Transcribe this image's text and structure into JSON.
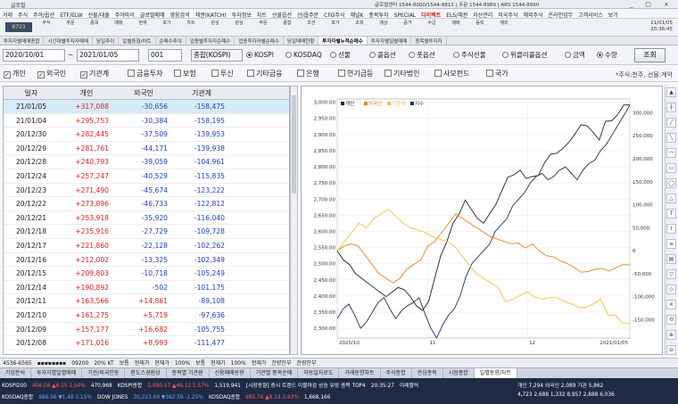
{
  "app": {
    "title": "글로벌",
    "info": "글로벌센터 1544-8000/1544-8811 | 주문 1544-8989 | ARS 1544-8990",
    "winbtns": "_ □ ×"
  },
  "menu": [
    "거래",
    "주식",
    "주야/옵션",
    "ETF/ELW",
    "선물/대출",
    "주야마이",
    "글로벌매매",
    "영웅검색",
    "채권(KATCH)",
    "투자정보",
    "차트",
    "선물옵션",
    "선/옵주문",
    "CFD주식",
    "채널K",
    "종목투자",
    "SPECIAL",
    "다이렉트",
    "ELS/채권",
    "자산관리",
    "미국주식",
    "해외주식",
    "온라인업무",
    "고객서비스",
    "보기"
  ],
  "menu_hot": "다이렉트",
  "toolbar": {
    "account": "8723",
    "items": [
      "주식",
      "주문",
      "종목",
      "매매",
      "현재",
      "호가",
      "차트",
      "관심",
      "관심",
      "주문",
      "종합",
      "조건",
      "호가",
      "조회",
      "예상",
      "증거",
      "수급",
      "매매",
      "등락",
      "해외"
    ],
    "clock_date": "21/01/05",
    "clock_time": "20:36:45"
  },
  "tabs": [
    "투자자별매매종합",
    "시간대별투자자매매",
    "당일추이",
    "일별동향/차트",
    "순매수추이",
    "업종별투자자순매수",
    "업종투자자별순매수",
    "당일매매현황",
    "투자자별누적순매수",
    "투자자별일별매매",
    "종목별투자자"
  ],
  "tabs_active": "투자자별누적순매수",
  "query": {
    "date_from": "2020/10/01",
    "date_to": "2021/01/05",
    "code": "001",
    "name": "종합(KOSPI)",
    "markets": [
      "KOSPI",
      "KOSDAQ",
      "선물",
      "콜옵션",
      "풋옵션",
      "주식선물",
      "위클리콜옵션"
    ],
    "market_selected": "KOSPI",
    "units": [
      "금액",
      "수량"
    ],
    "unit_selected": "수량",
    "search_label": "조회"
  },
  "investors": [
    {
      "label": "개인",
      "checked": true
    },
    {
      "label": "외국인",
      "checked": true
    },
    {
      "label": "기관계",
      "checked": true
    },
    {
      "label": "금융투자",
      "checked": false
    },
    {
      "label": "보험",
      "checked": false
    },
    {
      "label": "투신",
      "checked": false
    },
    {
      "label": "기타금융",
      "checked": false
    },
    {
      "label": "은행",
      "checked": false
    },
    {
      "label": "연기금등",
      "checked": false
    },
    {
      "label": "기타법인",
      "checked": false
    },
    {
      "label": "사모펀드",
      "checked": false
    },
    {
      "label": "국가",
      "checked": false
    }
  ],
  "unit_note": "*주식:천주, 선물:계약",
  "table": {
    "headers": [
      "일자",
      "개인",
      "외국인",
      "기관계"
    ],
    "rows": [
      [
        "21/01/05",
        "+317,088",
        "-30,656",
        "-158,475"
      ],
      [
        "21/01/04",
        "+295,753",
        "-30,384",
        "-158,195"
      ],
      [
        "20/12/30",
        "+282,445",
        "-37,509",
        "-139,953"
      ],
      [
        "20/12/29",
        "+281,761",
        "-44,171",
        "-139,938"
      ],
      [
        "20/12/28",
        "+240,793",
        "-39,059",
        "-104,961"
      ],
      [
        "20/12/24",
        "+257,247",
        "-40,529",
        "-115,835"
      ],
      [
        "20/12/23",
        "+271,490",
        "-45,674",
        "-123,222"
      ],
      [
        "20/12/22",
        "+273,896",
        "-46,733",
        "-122,812"
      ],
      [
        "20/12/21",
        "+253,918",
        "-35,920",
        "-116,040"
      ],
      [
        "20/12/18",
        "+235,916",
        "-27,729",
        "-109,728"
      ],
      [
        "20/12/17",
        "+221,860",
        "-22,128",
        "-102,262"
      ],
      [
        "20/12/16",
        "+212,002",
        "-13,325",
        "-102,349"
      ],
      [
        "20/12/15",
        "+209,803",
        "-10,718",
        "-105,249"
      ],
      [
        "20/12/14",
        "+190,892",
        "-502",
        "-101,175"
      ],
      [
        "20/12/11",
        "+163,566",
        "+14,861",
        "-89,108"
      ],
      [
        "20/12/10",
        "+161,275",
        "+5,719",
        "-97,636"
      ],
      [
        "20/12/09",
        "+157,177",
        "+16,682",
        "-105,755"
      ],
      [
        "20/12/08",
        "+171,016",
        "+8,993",
        "-111,477"
      ]
    ]
  },
  "chart_data": {
    "type": "line",
    "legend": [
      "개인",
      "외국인",
      "기관계",
      "지수"
    ],
    "colors": {
      "개인": "#222222",
      "외국인": "#e8841a",
      "기관계": "#f0c040",
      "지수": "#22305a"
    },
    "x_labels": [
      "2020/10",
      "11",
      "12",
      "2021/01/05"
    ],
    "left_axis": {
      "ticks": [
        "3,000.00",
        "2,950.00",
        "2,900.00",
        "2,850.00",
        "2,800.00",
        "2,750.00",
        "2,700.00",
        "2,650.00",
        "2,600.00",
        "2,550.00",
        "2,500.00",
        "2,450.00",
        "2,400.00",
        "2,350.00",
        "2,300.00"
      ],
      "range": [
        2270,
        3010
      ]
    },
    "right_axis": {
      "ticks": [
        "300,000",
        "250,000",
        "200,000",
        "150,000",
        "100,000",
        "50,000",
        "0",
        "-50,000",
        "-100,000",
        "-150,000"
      ],
      "range": [
        -190000,
        330000
      ]
    },
    "series": [
      {
        "name": "지수",
        "axis": "left",
        "values": [
          2330,
          2360,
          2375,
          2340,
          2300,
          2320,
          2350,
          2380,
          2395,
          2360,
          2330,
          2355,
          2370,
          2380,
          2395,
          2345,
          2300,
          2270,
          2310,
          2340,
          2360,
          2400,
          2460,
          2500,
          2520,
          2540,
          2560,
          2600,
          2620,
          2640,
          2680,
          2700,
          2720,
          2750,
          2770,
          2780,
          2760,
          2770,
          2790,
          2800,
          2780,
          2760,
          2790,
          2810,
          2820,
          2850,
          2870,
          2900,
          2930,
          2960,
          2990
        ]
      },
      {
        "name": "개인",
        "axis": "right",
        "values": [
          0,
          -20000,
          -30000,
          -50000,
          -60000,
          -70000,
          -80000,
          -90000,
          -100000,
          -90000,
          -80000,
          -85000,
          -100000,
          -120000,
          -130000,
          -110000,
          -60000,
          -10000,
          20000,
          60000,
          80000,
          110000,
          90000,
          70000,
          60000,
          80000,
          100000,
          130000,
          160000,
          165000,
          175000,
          157177,
          161275,
          163566,
          190892,
          209803,
          212002,
          221860,
          235916,
          253918,
          273896,
          271490,
          257247,
          240793,
          281761,
          282445,
          295753,
          317088,
          317088
        ]
      },
      {
        "name": "외국인",
        "axis": "right",
        "values": [
          0,
          10000,
          15000,
          10000,
          -10000,
          -30000,
          -50000,
          -60000,
          -70000,
          -60000,
          -40000,
          -30000,
          -20000,
          10000,
          20000,
          40000,
          60000,
          80000,
          70000,
          60000,
          50000,
          40000,
          30000,
          25000,
          20000,
          15000,
          16682,
          5719,
          14861,
          -502,
          -10718,
          -13325,
          -22128,
          -27729,
          -35920,
          -46733,
          -45674,
          -40529,
          -39059,
          -44171,
          -37509,
          -30384,
          -30656
        ]
      },
      {
        "name": "기관계",
        "axis": "right",
        "values": [
          0,
          20000,
          40000,
          60000,
          50000,
          70000,
          80000,
          90000,
          75000,
          60000,
          50000,
          45000,
          40000,
          30000,
          25000,
          20000,
          10000,
          -10000,
          -30000,
          -50000,
          -60000,
          -70000,
          -80000,
          -111477,
          -105755,
          -97636,
          -89108,
          -101175,
          -105249,
          -102349,
          -102262,
          -109728,
          -116040,
          -122812,
          -123222,
          -115835,
          -104961,
          -139938,
          -139953,
          -158195,
          -158475
        ]
      }
    ]
  },
  "status1": [
    "4536-6565",
    "▪▪▪▪▪▪▪▪",
    "09200",
    "20% KT",
    "보통",
    "현재가",
    "현재가",
    "100%",
    "보통",
    "현재가",
    "100%",
    "현재가",
    "잔량잔부",
    "잔량잔부"
  ],
  "taskbar": [
    "기업분석",
    "투자자별일별매매",
    "기관/외국인동",
    "환도스경원상",
    "종목별 기관원",
    "신용매매동향",
    "기관별 종목순매",
    "자동일자로도",
    "거래동향차트",
    "주식종합",
    "관심종목",
    "시장종합",
    "일별동향/차트"
  ],
  "taskbar_active": "일별동향/차트",
  "ticker": {
    "line1": [
      {
        "t": "KOSPI200",
        "c": ""
      },
      {
        "t": "406.08 ▲6.15 1.54%",
        "c": "up"
      },
      {
        "t": "470,968",
        "c": ""
      },
      {
        "t": "KOSPI종합",
        "c": ""
      },
      {
        "t": "2,990.57 ▲46.12 1.57%",
        "c": "up"
      },
      {
        "t": "1,519,941",
        "c": ""
      },
      {
        "t": "[시장동향] 증시 트렌드 미블마감 상승 유망 종목 TOP4",
        "c": ""
      },
      {
        "t": "20:35:27",
        "c": ""
      },
      {
        "t": "미래팔력",
        "c": ""
      }
    ],
    "line2": [
      {
        "t": "KOSDAQ종합",
        "c": ""
      },
      {
        "t": "986.56 ▼1.48 0.15%",
        "c": "dn"
      },
      {
        "t": "DOW JONES",
        "c": ""
      },
      {
        "t": "30,223.89 ▼382.59 -1.25%",
        "c": "dn"
      },
      {
        "t": "KOSDAQ종합",
        "c": ""
      },
      {
        "t": "985.76 ▲8.14 0.83%",
        "c": "up"
      },
      {
        "t": "1,668,166",
        "c": ""
      }
    ],
    "right1": "개인 7,294  외국인 2,089  기관 5,862",
    "right2": "4,723  2,688  1,332  8,957  2,888  6,036"
  }
}
